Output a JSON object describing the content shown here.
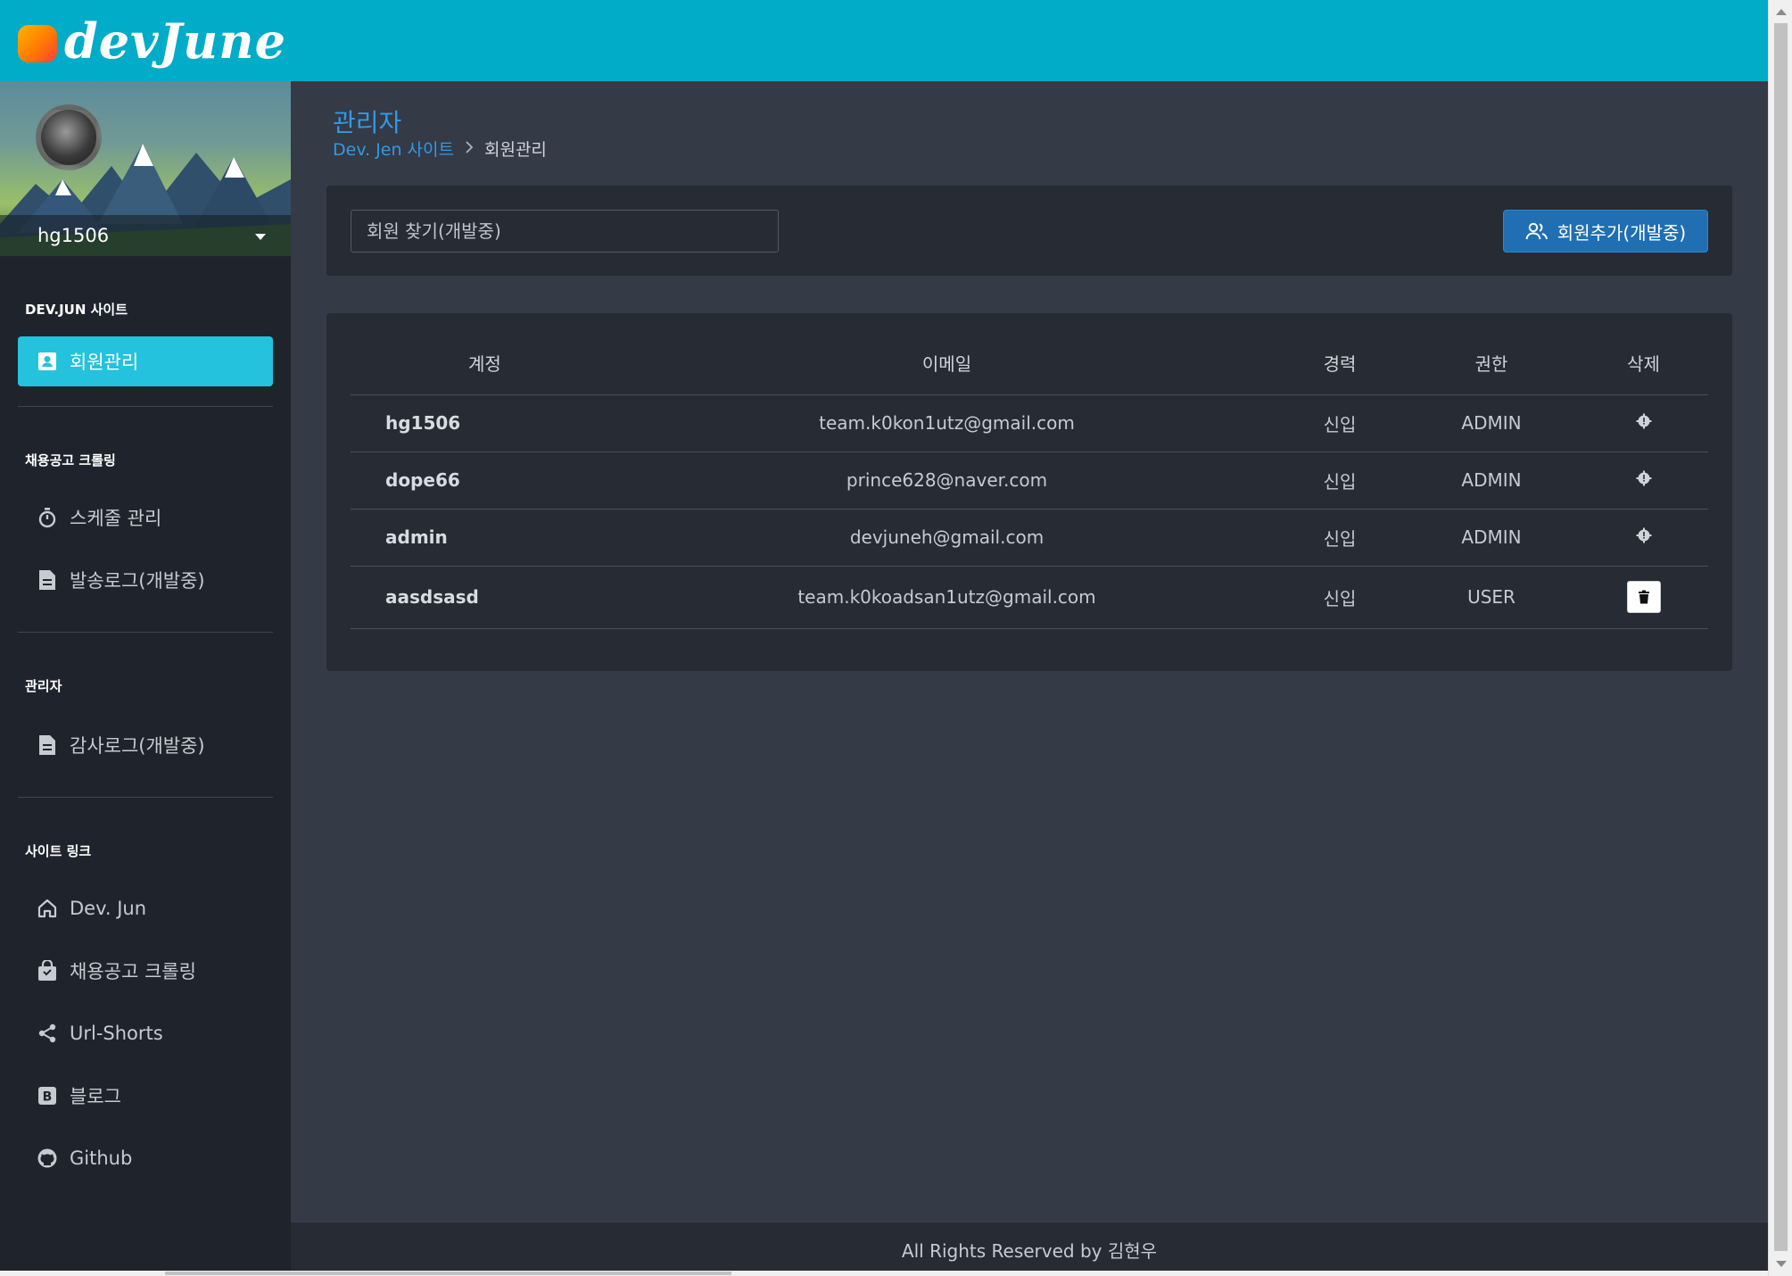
{
  "header": {
    "logo_text": "devJune"
  },
  "sidebar": {
    "profile_name": "hg1506",
    "sections": [
      {
        "heading": "DEV.JUN 사이트",
        "items": [
          {
            "label": "회원관리",
            "icon": "contact-card-icon",
            "active": true
          }
        ]
      },
      {
        "heading": "채용공고 크롤링",
        "items": [
          {
            "label": "스케줄 관리",
            "icon": "stopwatch-icon"
          },
          {
            "label": "발송로그(개발중)",
            "icon": "document-icon"
          }
        ]
      },
      {
        "heading": "관리자",
        "items": [
          {
            "label": "감사로그(개발중)",
            "icon": "document-icon"
          }
        ]
      },
      {
        "heading": "사이트 링크",
        "items": [
          {
            "label": "Dev. Jun",
            "icon": "home-icon"
          },
          {
            "label": "채용공고 크롤링",
            "icon": "shopping-bag-icon"
          },
          {
            "label": "Url-Shorts",
            "icon": "share-icon"
          },
          {
            "label": "블로그",
            "icon": "blog-b-icon"
          },
          {
            "label": "Github",
            "icon": "github-icon"
          }
        ]
      }
    ]
  },
  "page": {
    "title": "관리자",
    "breadcrumb": {
      "link": "Dev. Jen 사이트",
      "current": "회원관리"
    }
  },
  "search": {
    "placeholder": "회원 찾기(개발중)"
  },
  "add_button": {
    "label": "회원추가(개발중)",
    "icon": "users-icon"
  },
  "table": {
    "headers": [
      "계정",
      "이메일",
      "경력",
      "권한",
      "삭제"
    ],
    "rows": [
      {
        "account": "hg1506",
        "email": "team.k0kon1utz@gmail.com",
        "career": "신입",
        "role": "ADMIN",
        "delete": "gear-icon"
      },
      {
        "account": "dope66",
        "email": "prince628@naver.com",
        "career": "신입",
        "role": "ADMIN",
        "delete": "gear-icon"
      },
      {
        "account": "admin",
        "email": "devjuneh@gmail.com",
        "career": "신입",
        "role": "ADMIN",
        "delete": "gear-icon"
      },
      {
        "account": "aasdsasd",
        "email": "team.k0koadsan1utz@gmail.com",
        "career": "신입",
        "role": "USER",
        "delete": "trash-icon"
      }
    ]
  },
  "footer": {
    "text": "All Rights Reserved by 김현우"
  },
  "colors": {
    "header": "#00acc8",
    "active_nav": "#24c2dc",
    "link": "#2f9ae8",
    "primary_button": "#1f6fb2",
    "sidebar": "#1f242c",
    "content_bg": "#343a46",
    "card_bg": "#262b34"
  }
}
